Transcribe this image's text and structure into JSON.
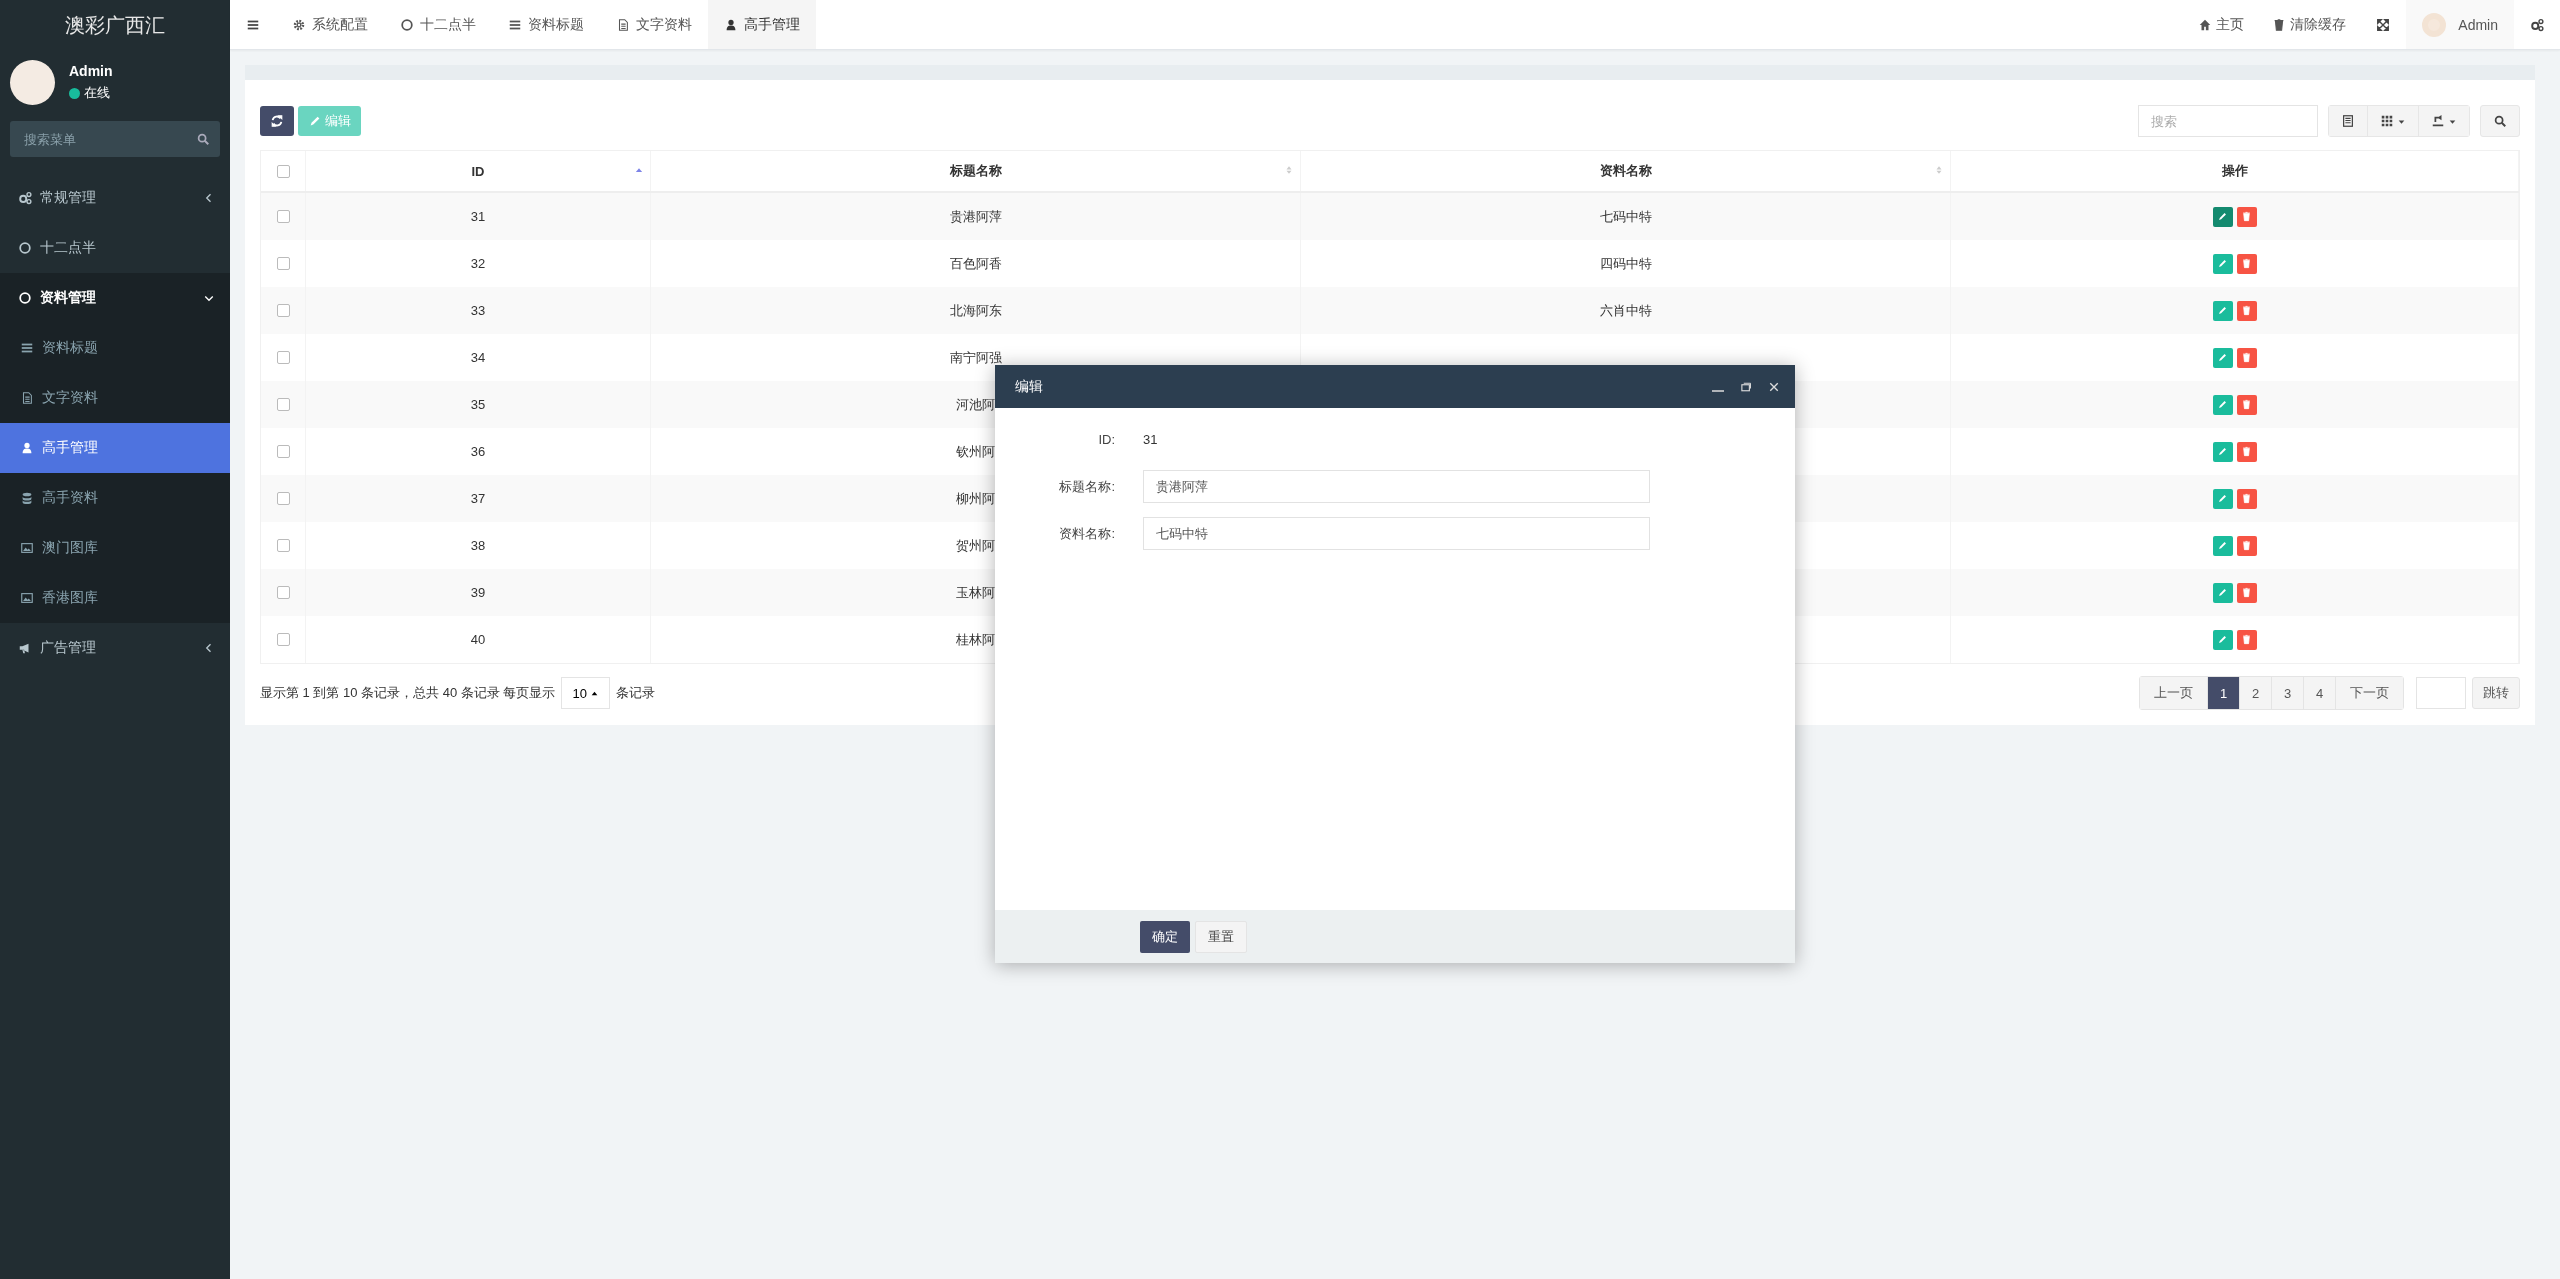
{
  "sidebar": {
    "logo": "澳彩广西汇",
    "user": {
      "name": "Admin",
      "status": "在线"
    },
    "search": {
      "placeholder": "搜索菜单"
    },
    "menu": [
      {
        "label": "常规管理",
        "kind": "gears",
        "expanded": false,
        "selected": false
      },
      {
        "label": "十二点半",
        "kind": "circle",
        "selected": false
      },
      {
        "label": "资料管理",
        "kind": "circle",
        "expanded": true,
        "selected": false,
        "children": [
          {
            "label": "资料标题",
            "kind": "list",
            "selected": false
          },
          {
            "label": "文字资料",
            "kind": "file",
            "selected": false
          },
          {
            "label": "高手管理",
            "kind": "user",
            "selected": true
          },
          {
            "label": "高手资料",
            "kind": "database",
            "selected": false
          },
          {
            "label": "澳门图库",
            "kind": "image",
            "selected": false
          },
          {
            "label": "香港图库",
            "kind": "image",
            "selected": false
          }
        ]
      },
      {
        "label": "广告管理",
        "kind": "bullhorn",
        "expanded": false,
        "selected": false
      }
    ]
  },
  "tabs": [
    {
      "label": "系统配置",
      "kind": "cog",
      "selected": false
    },
    {
      "label": "十二点半",
      "kind": "circle",
      "selected": false
    },
    {
      "label": "资料标题",
      "kind": "list",
      "selected": false
    },
    {
      "label": "文字资料",
      "kind": "file",
      "selected": false
    },
    {
      "label": "高手管理",
      "kind": "user",
      "selected": true
    }
  ],
  "header_links": [
    {
      "label": "主页",
      "kind": "home"
    },
    {
      "label": "清除缓存",
      "kind": "trash"
    }
  ],
  "header_user": {
    "name": "Admin"
  },
  "toolbar": {
    "edit_button": {
      "label": "编辑",
      "disabled": true
    },
    "search": {
      "placeholder": "搜索"
    }
  },
  "table": {
    "all_checked": false,
    "columns": [
      {
        "label": "ID",
        "sorted": true
      },
      {
        "label": "标题名称",
        "sorted": false
      },
      {
        "label": "资料名称",
        "sorted": false
      },
      {
        "label": "操作"
      }
    ],
    "rows": [
      {
        "checked": false,
        "id": "31",
        "title": "贵港阿萍",
        "name": "七码中特",
        "edit_focused": true
      },
      {
        "checked": false,
        "id": "32",
        "title": "百色阿香",
        "name": "四码中特",
        "edit_focused": false
      },
      {
        "checked": false,
        "id": "33",
        "title": "北海阿东",
        "name": "六肖中特",
        "edit_focused": false
      },
      {
        "checked": false,
        "id": "34",
        "title": "南宁阿强",
        "edit_focused": false
      },
      {
        "checked": false,
        "id": "35",
        "title": "河池阿",
        "edit_focused": false
      },
      {
        "checked": false,
        "id": "36",
        "title": "钦州阿",
        "edit_focused": false
      },
      {
        "checked": false,
        "id": "37",
        "title": "柳州阿",
        "edit_focused": false
      },
      {
        "checked": false,
        "id": "38",
        "title": "贺州阿",
        "edit_focused": false
      },
      {
        "checked": false,
        "id": "39",
        "title": "玉林阿",
        "edit_focused": false
      },
      {
        "checked": false,
        "id": "40",
        "title": "桂林阿",
        "edit_focused": false
      }
    ]
  },
  "footer": {
    "summary": "显示第 1 到第 10 条记录，总共 40 条记录 每页显示",
    "page_size": "10",
    "suffix": "条记录"
  },
  "pagination": {
    "prev": "上一页",
    "pages": [
      {
        "label": "1",
        "selected": true
      },
      {
        "label": "2",
        "selected": false
      },
      {
        "label": "3",
        "selected": false
      },
      {
        "label": "4",
        "selected": false
      }
    ],
    "next": "下一页",
    "jump": "跳转"
  },
  "modal": {
    "title": "编辑",
    "fields": [
      {
        "label": "ID:",
        "value": "31",
        "kind": "static"
      },
      {
        "label": "标题名称:",
        "value": "贵港阿萍",
        "kind": "input"
      },
      {
        "label": "资料名称:",
        "value": "七码中特",
        "kind": "input"
      }
    ],
    "buttons": [
      {
        "label": "确定",
        "kind": "primary"
      },
      {
        "label": "重置",
        "kind": "default"
      }
    ]
  }
}
